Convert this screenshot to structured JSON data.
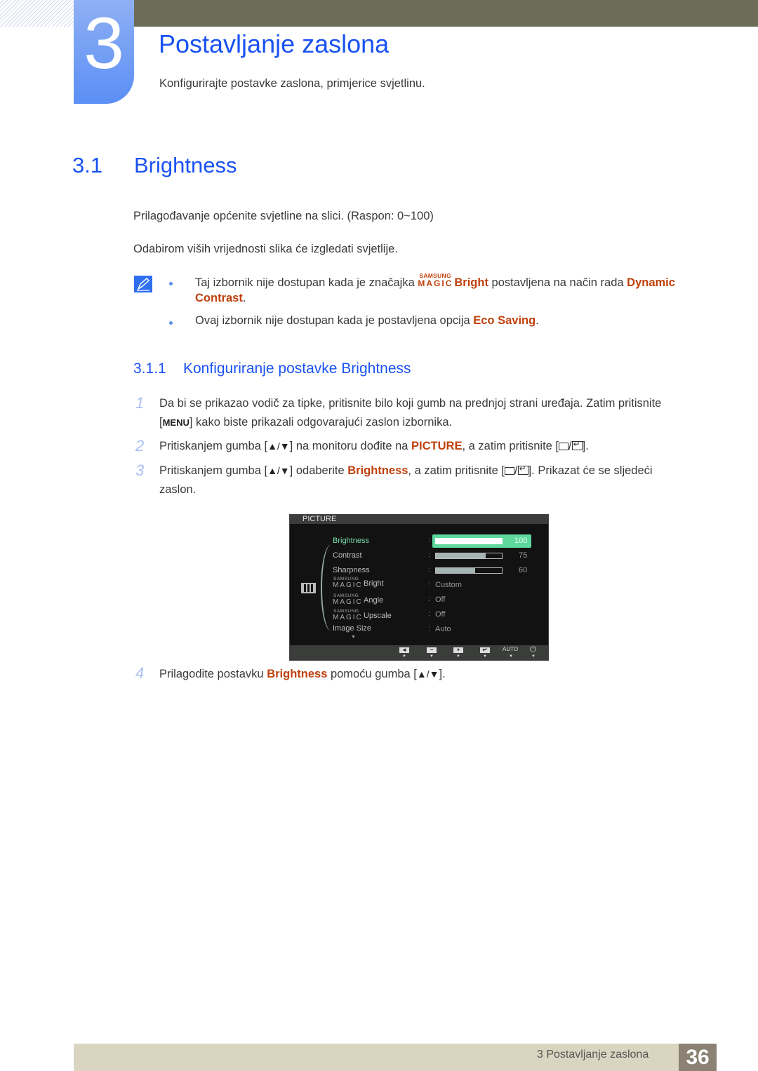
{
  "chapter": {
    "number": "3",
    "title": "Postavljanje zaslona",
    "subtitle": "Konfigurirajte postavke zaslona, primjerice svjetlinu."
  },
  "section": {
    "number": "3.1",
    "title": "Brightness",
    "para1": "Prilagođavanje općenite svjetline na slici. (Raspon: 0~100)",
    "para2": "Odabirom viših vrijednosti slika će izgledati svjetlije."
  },
  "notes": {
    "icon": "note-pencil-icon",
    "note1": {
      "pre": "Taj izbornik nije dostupan kada je značajka ",
      "magic_top": "SAMSUNG",
      "magic_bottom": "MAGIC",
      "feature": "Bright",
      "mid": " postavljena na način rada ",
      "mode_line1": "Dynamic",
      "mode_line2": "Contrast",
      "end": "."
    },
    "note2": {
      "pre": "Ovaj izbornik nije dostupan kada je postavljena opcija ",
      "option": "Eco Saving",
      "end": "."
    }
  },
  "subsection": {
    "number": "3.1.1",
    "title": "Konfiguriranje postavke Brightness"
  },
  "steps": [
    {
      "num": "1",
      "line1": "Da bi se prikazao vodič za tipke, pritisnite bilo koji gumb na prednjoj strani uređaja. Zatim pritisnite",
      "key": "MENU",
      "line2": " kako biste prikazali odgovarajući zaslon izbornika."
    },
    {
      "num": "2",
      "pre": "Pritiskanjem gumba [",
      "arrows": "▲/▼",
      "mid": "] na monitoru dođite na ",
      "target": "PICTURE",
      "post": ", a zatim pritisnite [",
      "end": "]."
    },
    {
      "num": "3",
      "pre": "Pritiskanjem gumba [",
      "arrows": "▲/▼",
      "mid": "] odaberite ",
      "target": "Brightness",
      "post": ", a zatim pritisnite [",
      "end": "]. Prikazat će se sljedeći",
      "line2": "zaslon."
    },
    {
      "num": "4",
      "pre": "Prilagodite postavku ",
      "target": "Brightness",
      "mid": " pomoću gumba [",
      "arrows": "▲/▼",
      "end": "]."
    }
  ],
  "osd": {
    "title": "PICTURE",
    "rows": [
      {
        "label": "Brightness",
        "value": 100,
        "type": "bar",
        "selected": true
      },
      {
        "label": "Contrast",
        "value": 75,
        "type": "bar"
      },
      {
        "label": "Sharpness",
        "value": 60,
        "type": "bar"
      },
      {
        "magic_top": "SAMSUNG",
        "magic_bottom": "MAGIC",
        "label": "Bright",
        "value": "Custom"
      },
      {
        "magic_top": "SAMSUNG",
        "magic_bottom": "MAGIC",
        "label": "Angle",
        "value": "Off"
      },
      {
        "magic_top": "SAMSUNG",
        "magic_bottom": "MAGIC",
        "label": "Upscale",
        "value": "Off"
      },
      {
        "label": "Image Size",
        "value": "Auto"
      }
    ],
    "colon": ":",
    "footer_buttons": [
      "◄",
      "−",
      "+",
      "↵",
      "AUTO",
      "⏻"
    ],
    "down_arrow": "▼"
  },
  "footer": {
    "text": "3 Postavljanje zaslona",
    "page": "36"
  }
}
